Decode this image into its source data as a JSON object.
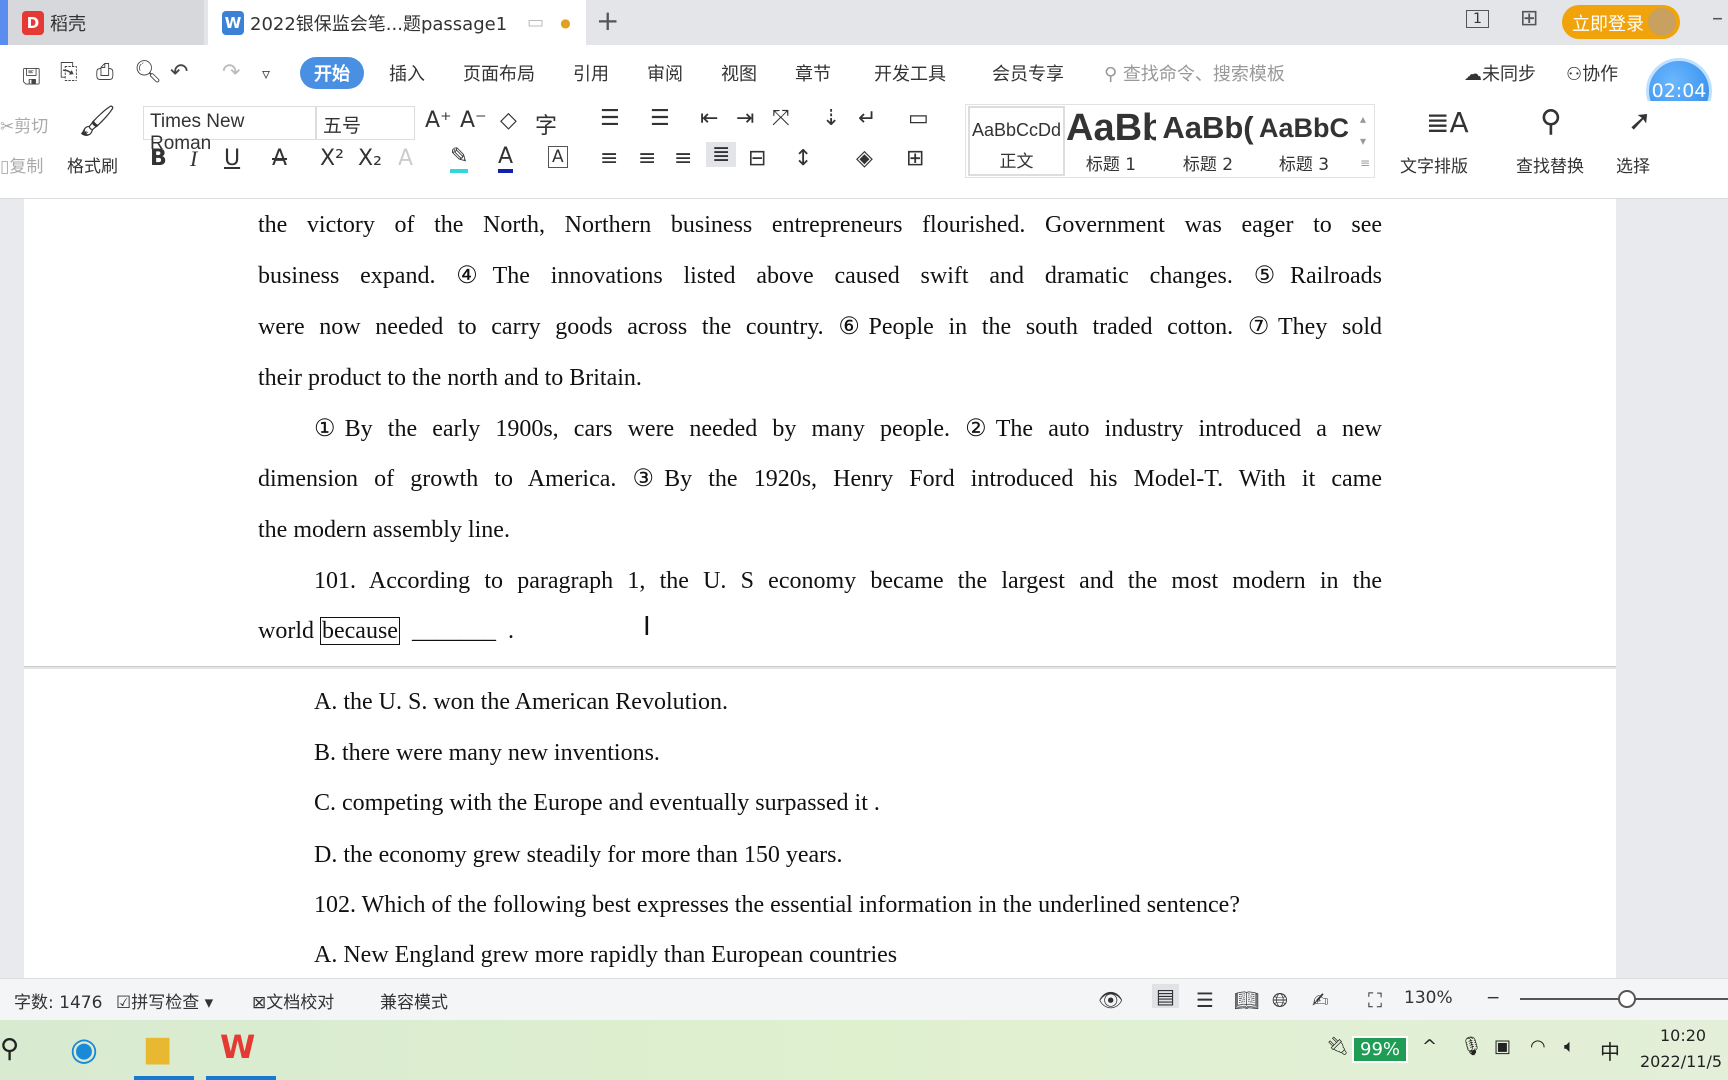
{
  "tabs": [
    {
      "label": "稻壳",
      "icon": "daoke-logo"
    },
    {
      "label": "2022银保监会笔...题passage1",
      "icon": "wps-writer-icon"
    }
  ],
  "titlebar": {
    "new_tab": "+",
    "login": "立即登录",
    "page_icon": "1"
  },
  "quick_access": [
    "save-icon",
    "export-pdf-icon",
    "print-icon",
    "print-preview-icon",
    "undo-icon",
    "redo-icon",
    "customize-icon"
  ],
  "menu": [
    "开始",
    "插入",
    "页面布局",
    "引用",
    "审阅",
    "视图",
    "章节",
    "开发工具",
    "会员专享"
  ],
  "search_placeholder": "查找命令、搜索模板",
  "right_menu": {
    "sync": "未同步",
    "collab": "协作",
    "timer": "02:04"
  },
  "ribbon": {
    "cut": "剪切",
    "copy": "复制",
    "format_painter": "格式刷",
    "font": "Times New Roman",
    "size": "五号",
    "styles": [
      {
        "preview": "AaBbCcDd",
        "label": "正文"
      },
      {
        "preview": "AaBb",
        "label": "标题 1"
      },
      {
        "preview": "AaBb(",
        "label": "标题 2"
      },
      {
        "preview": "AaBbC",
        "label": "标题 3"
      }
    ],
    "text_layout": "文字排版",
    "find_replace": "查找替换",
    "select": "选择"
  },
  "colors": {
    "accent": "#4a90e2",
    "login": "#f0a30a",
    "highlight": "#33d6e0",
    "font_color": "#1020b0"
  },
  "document": {
    "lines": [
      "the victory of the North, Northern business entrepreneurs flourished. Government was eager to see",
      "business expand.  ④The innovations listed above caused swift and dramatic changes.  ⑤Railroads",
      "were now needed to carry goods across the country.  ⑥People in the south traded cotton.  ⑦They sold",
      "their product to the north and to Britain.",
      "①By the early 1900s, cars were needed by many people.  ②The auto industry introduced a new",
      "dimension of growth to America.  ③By the 1920s, Henry Ford introduced his Model-T. With it came",
      "the modern assembly line.",
      "101. According to paragraph 1, the U. S economy became the largest and the most modern in the"
    ],
    "q_line_start": "world ",
    "q_boxed": "because",
    "q_blank": "  _______  .",
    "lines2": [
      "A. the U. S. won the American Revolution.",
      "B. there were many new inventions.",
      "C. competing with the Europe and eventually surpassed it .",
      "D. the economy grew steadily for more than 150 years.",
      "102. Which of the following best expresses the essential information in the underlined sentence?",
      "A. New England grew more rapidly than European countries"
    ]
  },
  "status": {
    "word_count": "字数: 1476",
    "spell": "拼写检查",
    "proof": "文档校对",
    "compat": "兼容模式",
    "zoom": "130%",
    "zoom_level": 130
  },
  "taskbar": {
    "battery": "99%",
    "ime": "中",
    "time": "10:20",
    "date": "2022/11/5"
  }
}
